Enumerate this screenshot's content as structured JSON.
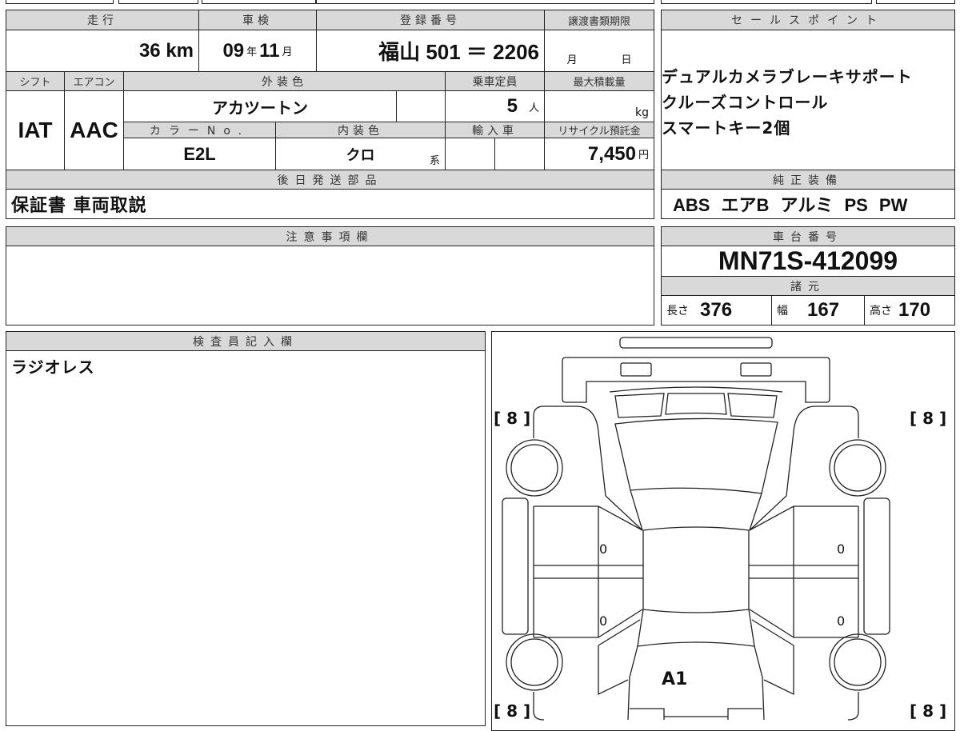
{
  "main": {
    "mileage_label": "走行",
    "mileage_value": "36",
    "mileage_unit": "km",
    "shaken_label": "車検",
    "shaken_year": "09",
    "year_unit": "年",
    "shaken_month": "11",
    "month_unit": "月",
    "registration_label": "登録番号",
    "registration_value": "福山 501 ＝ 2206",
    "transfer_deadline_label": "譲渡書類期限",
    "transfer_month_unit": "月",
    "transfer_day_unit": "日",
    "shift_label": "シフト",
    "shift_value": "IAT",
    "aircon_label": "エアコン",
    "aircon_value": "AAC",
    "exterior_color_label": "外装色",
    "exterior_color_value": "アカツートン",
    "capacity_label": "乗車定員",
    "capacity_value": "5",
    "capacity_unit": "人",
    "max_load_label": "最大積載量",
    "max_load_unit": "kg",
    "color_no_label": "カラーNo.",
    "color_no_value": "E2L",
    "interior_color_label": "内装色",
    "interior_color_value": "クロ",
    "interior_color_suffix": "系",
    "import_label": "輸入車",
    "recycle_label": "リサイクル預託金",
    "recycle_value": "7,450",
    "recycle_unit": "円",
    "later_parts_label": "後日発送部品",
    "later_parts_value": "保証書 車両取説"
  },
  "sales_points": {
    "label": "セールスポイント",
    "lines": [
      "デュアルカメラブレーキサポート",
      "クルーズコントロール",
      "スマートキー2個"
    ]
  },
  "equipment": {
    "label": "純正装備",
    "value": "ABS エアB アルミ PS PW"
  },
  "notes": {
    "label": "注意事項欄"
  },
  "chassis": {
    "label": "車台番号",
    "value": "MN71S-412099"
  },
  "specs": {
    "label": "諸元",
    "length_label": "長さ",
    "length": "376",
    "width_label": "幅",
    "width": "167",
    "height_label": "高さ",
    "height": "170"
  },
  "inspector": {
    "label": "検査員記入欄",
    "value": "ラジオレス"
  },
  "diagram": {
    "tire_front_left": "[ 8 ]",
    "tire_front_right": "[ 8 ]",
    "tire_rear_left": "[ 8 ]",
    "tire_rear_right": "[ 8 ]",
    "door_fl": "0",
    "door_rl": "0",
    "door_fr": "0",
    "door_rr": "0",
    "rear_mark": "A1"
  }
}
